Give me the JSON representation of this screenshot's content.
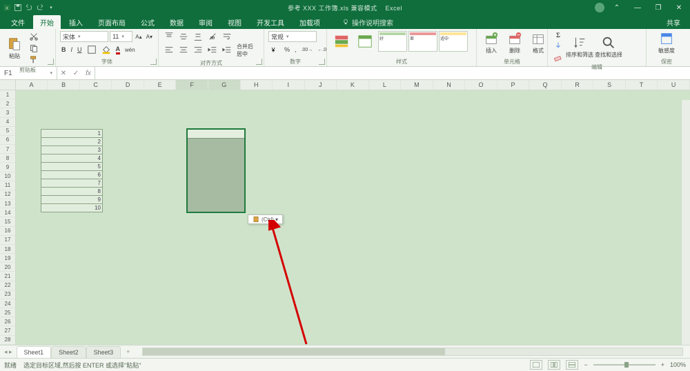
{
  "titlebar": {
    "doc": "参考 XXX 工作簿.xls 兼容模式",
    "app": "Excel",
    "save_icon": "save",
    "undo_icon": "undo",
    "redo_icon": "redo",
    "user_label": "",
    "min": "—",
    "max": "▭",
    "restore": "❐",
    "close": "✕"
  },
  "tabs": {
    "file": "文件",
    "home": "开始",
    "insert": "插入",
    "layout": "页面布局",
    "formulas": "公式",
    "data": "数据",
    "review": "审阅",
    "view": "视图",
    "dev": "开发工具",
    "addins": "加载项",
    "tell_label": "操作说明搜索",
    "share": "共享"
  },
  "ribbon": {
    "clipboard": {
      "label": "剪贴板",
      "paste": "粘贴",
      "cut": "剪切",
      "copy": "复制",
      "brush": "格式刷"
    },
    "font": {
      "label": "字体",
      "name": "宋体",
      "size": "11"
    },
    "align": {
      "label": "对齐方式",
      "merge": "合并后居中"
    },
    "number": {
      "label": "数字",
      "format": "常规"
    },
    "styles": {
      "label": "样式",
      "cond": "条件格式",
      "table": "套用表格格式",
      "cell": "单元格样式"
    },
    "cells": {
      "label": "单元格",
      "insert": "插入",
      "delete": "删除",
      "format": "格式"
    },
    "editing": {
      "label": "编辑",
      "sum": "自动求和",
      "fill": "填充",
      "clear": "清除",
      "sort": "排序和筛选",
      "find": "查找和选择"
    },
    "sens": {
      "label": "保密",
      "btn": "敏感度"
    }
  },
  "fx": {
    "name": "F1",
    "value": ""
  },
  "columns": [
    "A",
    "B",
    "C",
    "D",
    "E",
    "F",
    "G",
    "H",
    "I",
    "J",
    "K",
    "L",
    "M",
    "N",
    "O",
    "P",
    "Q",
    "R",
    "S",
    "T",
    "U"
  ],
  "rows_count": 28,
  "tableA": {
    "values": [
      "1",
      "2",
      "3",
      "4",
      "5",
      "6",
      "7",
      "8",
      "9",
      "10"
    ]
  },
  "paste_options": {
    "label": "(Ctrl) ▾"
  },
  "sheets": {
    "s1": "Sheet1",
    "s2": "Sheet2",
    "s3": "Sheet3",
    "add": "+"
  },
  "status": {
    "mode": "就绪",
    "hint": "选定目标区域,然后按 ENTER 或选择\"粘贴\"",
    "zoom": "100%",
    "minus": "−",
    "plus": "+"
  }
}
